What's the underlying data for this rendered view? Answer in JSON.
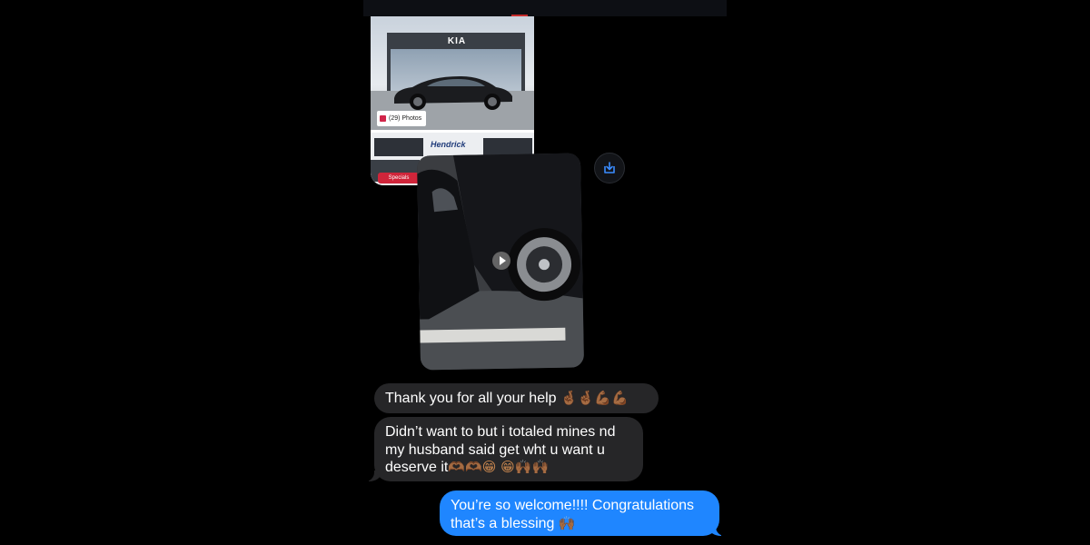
{
  "screenshot_card": {
    "photos_badge": "(29) Photos",
    "dealer_logo": "KIA",
    "dealer_name": "Hendrick",
    "specials_label": "Specials"
  },
  "video_card": {
    "play_icon": "play-icon"
  },
  "actions": {
    "save_icon": "download-icon"
  },
  "messages": [
    {
      "direction": "received",
      "text": "Thank you for all your help",
      "emoji": "🤞🏾🤞🏾💪🏾💪🏾"
    },
    {
      "direction": "received",
      "text": "Didn’t want to but i totaled mines nd my husband said get wht u want u deserve it",
      "emoji": "🫶🏾🫶🏾😁 😁🙌🏾🙌🏾"
    },
    {
      "direction": "sent",
      "text": "You’re so welcome!!!! Congratulations that’s a blessing",
      "emoji": "🙌🏾"
    }
  ],
  "colors": {
    "background": "#000000",
    "received_bubble": "#262628",
    "sent_bubble": "#1f86ff",
    "accent_icon": "#3a8cff"
  }
}
